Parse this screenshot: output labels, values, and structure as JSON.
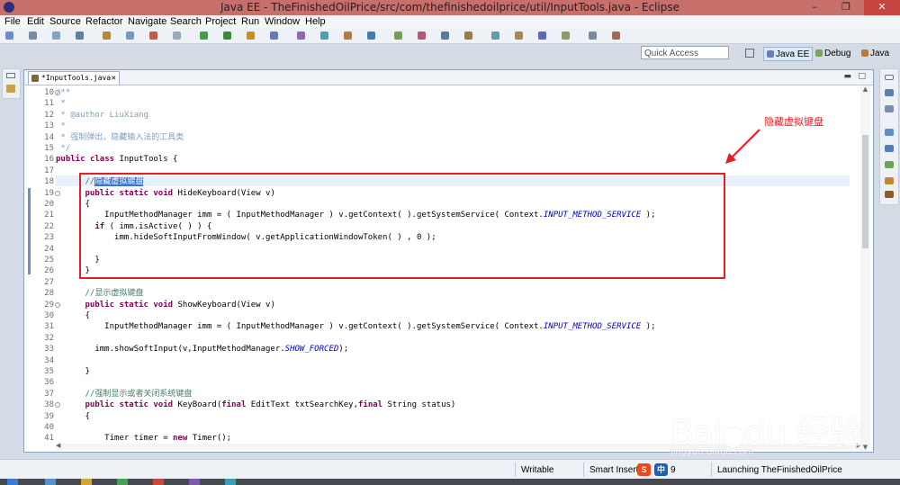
{
  "window": {
    "title": "Java EE - TheFinishedOilPrice/src/com/thefinishedoilprice/util/InputTools.java - Eclipse"
  },
  "menu": [
    "File",
    "Edit",
    "Source",
    "Refactor",
    "Navigate",
    "Search",
    "Project",
    "Run",
    "Window",
    "Help"
  ],
  "quick_access": {
    "placeholder": "Quick Access"
  },
  "perspectives": [
    "Java EE",
    "Debug",
    "Java"
  ],
  "editor": {
    "tab_label": "*InputTools.java",
    "lines": [
      {
        "n": "10",
        "fold": "⊖",
        "segs": [
          [
            "cd",
            "/**"
          ]
        ]
      },
      {
        "n": "11",
        "segs": [
          [
            "cd",
            " *"
          ]
        ]
      },
      {
        "n": "12",
        "segs": [
          [
            "cd",
            " * @author LiuXiang"
          ]
        ]
      },
      {
        "n": "13",
        "segs": [
          [
            "cd",
            " *"
          ]
        ]
      },
      {
        "n": "14",
        "segs": [
          [
            "cd",
            " * 强制弹出，隐藏输入法的工具类"
          ]
        ]
      },
      {
        "n": "15",
        "segs": [
          [
            "cd",
            " */"
          ]
        ]
      },
      {
        "n": "16",
        "segs": [
          [
            "kw",
            "public"
          ],
          [
            "",
            " "
          ],
          [
            "kw",
            "class"
          ],
          [
            "",
            " InputTools {"
          ]
        ]
      },
      {
        "n": "17",
        "segs": []
      },
      {
        "n": "18",
        "segs": [
          [
            "",
            "      "
          ],
          [
            "cm",
            "//"
          ],
          [
            "sel",
            "隐藏虚拟键盘"
          ]
        ]
      },
      {
        "n": "19",
        "fold": "⊖",
        "segs": [
          [
            "",
            "      "
          ],
          [
            "kw",
            "public"
          ],
          [
            "",
            " "
          ],
          [
            "kw",
            "static"
          ],
          [
            "",
            " "
          ],
          [
            "kw",
            "void"
          ],
          [
            "",
            " HideKeyboard(View v)"
          ]
        ]
      },
      {
        "n": "20",
        "segs": [
          [
            "",
            "      {"
          ]
        ]
      },
      {
        "n": "21",
        "segs": [
          [
            "",
            "          InputMethodManager imm = ( InputMethodManager ) v.getContext( ).getSystemService( Context."
          ],
          [
            "ital",
            "INPUT_METHOD_SERVICE"
          ],
          [
            "",
            " );"
          ]
        ]
      },
      {
        "n": "22",
        "segs": [
          [
            "",
            "        "
          ],
          [
            "kw",
            "if"
          ],
          [
            "",
            " ( imm.isActive( ) ) {"
          ]
        ]
      },
      {
        "n": "23",
        "segs": [
          [
            "",
            "            imm.hideSoftInputFromWindow( v.getApplicationWindowToken( ) , 0 );"
          ]
        ]
      },
      {
        "n": "24",
        "segs": []
      },
      {
        "n": "25",
        "segs": [
          [
            "",
            "        }"
          ]
        ]
      },
      {
        "n": "26",
        "segs": [
          [
            "",
            "      }"
          ]
        ]
      },
      {
        "n": "27",
        "segs": []
      },
      {
        "n": "28",
        "segs": [
          [
            "",
            "      "
          ],
          [
            "cm",
            "//显示虚拟键盘"
          ]
        ]
      },
      {
        "n": "29",
        "fold": "⊖",
        "segs": [
          [
            "",
            "      "
          ],
          [
            "kw",
            "public"
          ],
          [
            "",
            " "
          ],
          [
            "kw",
            "static"
          ],
          [
            "",
            " "
          ],
          [
            "kw",
            "void"
          ],
          [
            "",
            " ShowKeyboard(View v)"
          ]
        ]
      },
      {
        "n": "30",
        "segs": [
          [
            "",
            "      {"
          ]
        ]
      },
      {
        "n": "31",
        "segs": [
          [
            "",
            "          InputMethodManager imm = ( InputMethodManager ) v.getContext( ).getSystemService( Context."
          ],
          [
            "ital",
            "INPUT_METHOD_SERVICE"
          ],
          [
            "",
            " );"
          ]
        ]
      },
      {
        "n": "32",
        "segs": []
      },
      {
        "n": "33",
        "segs": [
          [
            "",
            "        imm.showSoftInput(v,InputMethodManager."
          ],
          [
            "ital",
            "SHOW_FORCED"
          ],
          [
            "",
            ");"
          ]
        ]
      },
      {
        "n": "34",
        "segs": []
      },
      {
        "n": "35",
        "segs": [
          [
            "",
            "      }"
          ]
        ]
      },
      {
        "n": "36",
        "segs": []
      },
      {
        "n": "37",
        "segs": [
          [
            "",
            "      "
          ],
          [
            "cm",
            "//强制显示或者关闭系统键盘"
          ]
        ]
      },
      {
        "n": "38",
        "fold": "⊖",
        "segs": [
          [
            "",
            "      "
          ],
          [
            "kw",
            "public"
          ],
          [
            "",
            " "
          ],
          [
            "kw",
            "static"
          ],
          [
            "",
            " "
          ],
          [
            "kw",
            "void"
          ],
          [
            "",
            " KeyBoard("
          ],
          [
            "kw",
            "final"
          ],
          [
            "",
            " EditText txtSearchKey,"
          ],
          [
            "kw",
            "final"
          ],
          [
            "",
            " String status)"
          ]
        ]
      },
      {
        "n": "39",
        "segs": [
          [
            "",
            "      {"
          ]
        ]
      },
      {
        "n": "40",
        "segs": []
      },
      {
        "n": "41",
        "segs": [
          [
            "",
            "          Timer timer = "
          ],
          [
            "kw",
            "new"
          ],
          [
            "",
            " Timer();"
          ]
        ]
      }
    ]
  },
  "annotation": {
    "text": "隐藏虚拟键盘"
  },
  "status": {
    "writable": "Writable",
    "insert_mode": "Smart Insert",
    "ime_zh": "中",
    "position_fragment": "9",
    "launching": "Launching TheFinishedOilPrice"
  },
  "watermark": {
    "logo": "Bai du 经验",
    "url": "jingyan.baidu.com"
  }
}
